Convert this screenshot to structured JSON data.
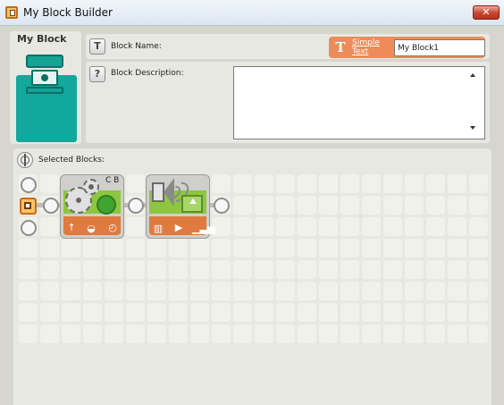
{
  "window": {
    "title": "My Block Builder",
    "close_symbol": "✕"
  },
  "left_panel": {
    "title": "My Block",
    "preview_icon": "my-block-icon"
  },
  "fields": {
    "name_label": "Block Name:",
    "name_icon": "name-tag-icon",
    "simple_text_label": "Simple Text",
    "simple_text_icon": "text-t-icon",
    "name_value": "My Block1",
    "description_label": "Block Description:",
    "description_icon": "question-icon",
    "description_value": ""
  },
  "workspace": {
    "selected_label": "Selected Blocks:",
    "selected_icon": "crosshair-icon",
    "blocks": [
      {
        "name": "Motor block",
        "ports": "C B",
        "icons": [
          "gear-icon",
          "power-icon"
        ],
        "bar_icons": [
          "↑",
          "speed-icon",
          "rotation-icon"
        ]
      },
      {
        "name": "Sound block",
        "icons": [
          "speaker-icon",
          "play-file-icon"
        ],
        "bar_icons": [
          "sound-file-icon",
          "▶",
          "volume-icon"
        ]
      }
    ]
  },
  "colors": {
    "accent_orange": "#ed8c5a",
    "block_teal": "#12a89c",
    "motor_green": "#8dc63f",
    "block_bar": "#e07a3e"
  }
}
